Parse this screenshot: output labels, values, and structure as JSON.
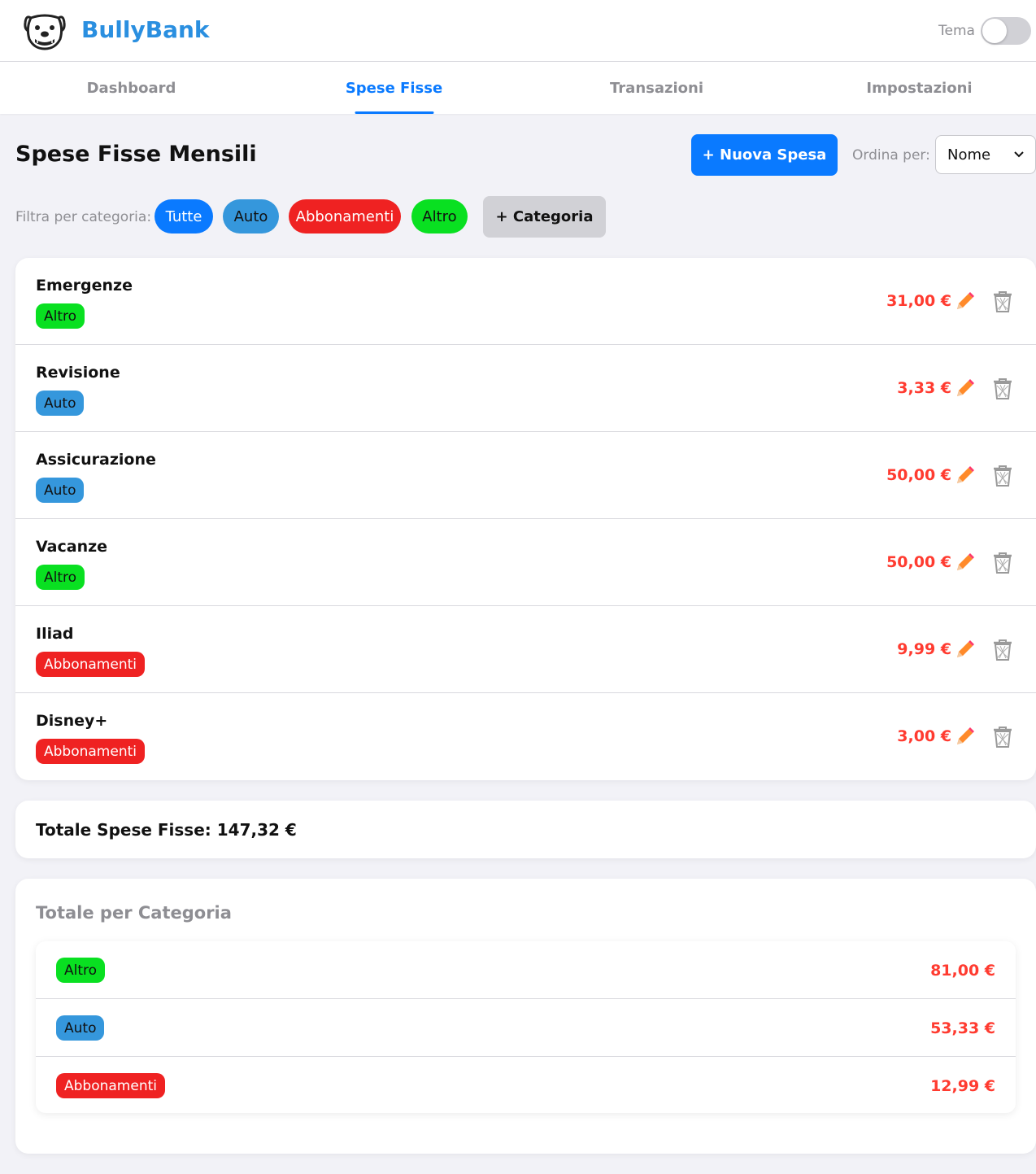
{
  "app": {
    "name": "BullyBank",
    "theme_label": "Tema"
  },
  "nav": {
    "tabs": [
      {
        "label": "Dashboard"
      },
      {
        "label": "Spese Fisse"
      },
      {
        "label": "Transazioni"
      },
      {
        "label": "Impostazioni"
      }
    ],
    "active": "Spese Fisse"
  },
  "page": {
    "title": "Spese Fisse Mensili",
    "new_button": "+ Nuova Spesa",
    "sort_label": "Ordina per:",
    "sort_value": "Nome",
    "filter_label": "Filtra per categoria:",
    "filters": [
      "Tutte",
      "Auto",
      "Abbonamenti",
      "Altro"
    ],
    "add_category": "+ Categoria"
  },
  "expenses": [
    {
      "name": "Emergenze",
      "category": "Altro",
      "amount": "31,00 €"
    },
    {
      "name": "Revisione",
      "category": "Auto",
      "amount": "3,33 €"
    },
    {
      "name": "Assicurazione",
      "category": "Auto",
      "amount": "50,00 €"
    },
    {
      "name": "Vacanze",
      "category": "Altro",
      "amount": "50,00 €"
    },
    {
      "name": "Iliad",
      "category": "Abbonamenti",
      "amount": "9,99 €"
    },
    {
      "name": "Disney+",
      "category": "Abbonamenti",
      "amount": "3,00 €"
    }
  ],
  "total": {
    "text": "Totale Spese Fisse: 147,32 €"
  },
  "category_totals": {
    "title": "Totale per Categoria",
    "rows": [
      {
        "category": "Altro",
        "amount": "81,00 €"
      },
      {
        "category": "Auto",
        "amount": "53,33 €"
      },
      {
        "category": "Abbonamenti",
        "amount": "12,99 €"
      }
    ]
  },
  "colors": {
    "accent": "#0a7aff",
    "amount": "#ff3b30",
    "tutte": "#0a7aff",
    "auto": "#3597dc",
    "abbonamenti": "#ef2222",
    "altro": "#09e021"
  },
  "icons": {
    "edit": "pencil-icon",
    "delete": "trash-icon",
    "logo": "bulldog-logo-icon"
  }
}
